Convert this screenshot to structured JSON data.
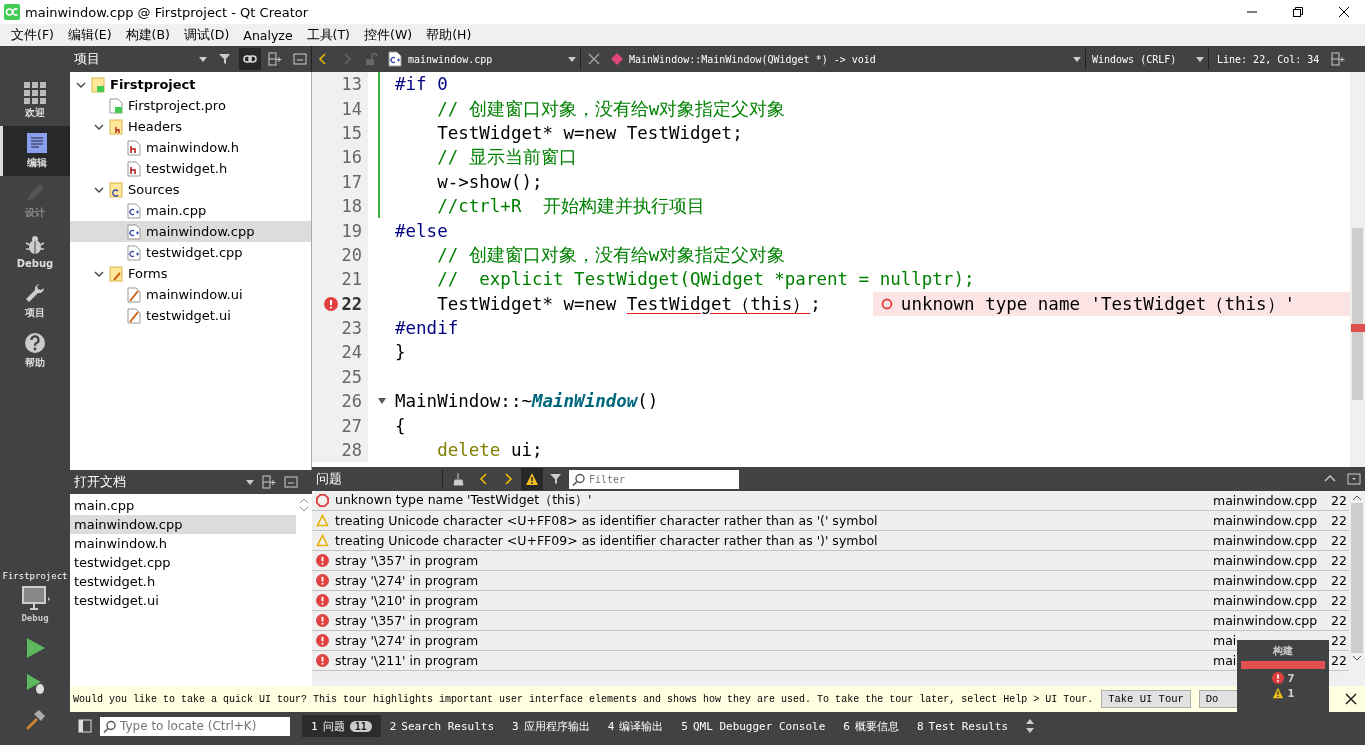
{
  "window": {
    "title": "mainwindow.cpp @ Firstproject - Qt Creator"
  },
  "menu": [
    "文件(F)",
    "编辑(E)",
    "构建(B)",
    "调试(D)",
    "Analyze",
    "工具(T)",
    "控件(W)",
    "帮助(H)"
  ],
  "modes": [
    {
      "label": "欢迎",
      "kind": "welcome",
      "selected": false,
      "disabled": false
    },
    {
      "label": "编辑",
      "kind": "edit",
      "selected": true,
      "disabled": false
    },
    {
      "label": "设计",
      "kind": "design",
      "selected": false,
      "disabled": true
    },
    {
      "label": "Debug",
      "kind": "debug",
      "selected": false,
      "disabled": false
    },
    {
      "label": "项目",
      "kind": "projects",
      "selected": false,
      "disabled": false
    },
    {
      "label": "帮助",
      "kind": "help",
      "selected": false,
      "disabled": false
    }
  ],
  "kit": {
    "project": "Firstproject",
    "build": "Debug"
  },
  "project_panel": {
    "title": "项目",
    "sync_on": true,
    "tree": [
      {
        "name": "Firstproject",
        "kind": "project",
        "expanded": true,
        "selected": false,
        "children": [
          {
            "name": "Firstproject.pro",
            "kind": "pro",
            "selected": false
          },
          {
            "name": "Headers",
            "kind": "headers",
            "expanded": true,
            "selected": false,
            "children": [
              {
                "name": "mainwindow.h",
                "kind": "h",
                "selected": false
              },
              {
                "name": "testwidget.h",
                "kind": "h",
                "selected": false
              }
            ]
          },
          {
            "name": "Sources",
            "kind": "sources",
            "expanded": true,
            "selected": false,
            "children": [
              {
                "name": "main.cpp",
                "kind": "cpp",
                "selected": false
              },
              {
                "name": "mainwindow.cpp",
                "kind": "cpp",
                "selected": true
              },
              {
                "name": "testwidget.cpp",
                "kind": "cpp",
                "selected": false
              }
            ]
          },
          {
            "name": "Forms",
            "kind": "forms",
            "expanded": true,
            "selected": false,
            "children": [
              {
                "name": "mainwindow.ui",
                "kind": "ui",
                "selected": false
              },
              {
                "name": "testwidget.ui",
                "kind": "ui",
                "selected": false
              }
            ]
          }
        ]
      }
    ]
  },
  "open_documents": {
    "title": "打开文档",
    "items": [
      {
        "name": "main.cpp",
        "selected": false
      },
      {
        "name": "mainwindow.cpp",
        "selected": true
      },
      {
        "name": "mainwindow.h",
        "selected": false
      },
      {
        "name": "testwidget.cpp",
        "selected": false
      },
      {
        "name": "testwidget.h",
        "selected": false
      },
      {
        "name": "testwidget.ui",
        "selected": false
      }
    ]
  },
  "editor": {
    "file": "mainwindow.cpp",
    "symbol": "MainWindow::MainWindow(QWidget *) -> void",
    "line_ending": "Windows (CRLF)",
    "position": "Line: 22, Col: 34",
    "lines": [
      {
        "number": "13",
        "changed": true,
        "tokens": [
          {
            "text": "#if 0",
            "kind": "preproc"
          }
        ]
      },
      {
        "number": "14",
        "changed": true,
        "tokens": [
          {
            "text": "    // 创建窗口对象，没有给w对象指定父对象",
            "kind": "comment"
          }
        ]
      },
      {
        "number": "15",
        "changed": true,
        "tokens": [
          {
            "text": "    TestWidget* w=new TestWidget;",
            "kind": "plain"
          }
        ]
      },
      {
        "number": "16",
        "changed": true,
        "tokens": [
          {
            "text": "    // 显示当前窗口",
            "kind": "comment"
          }
        ]
      },
      {
        "number": "17",
        "changed": true,
        "tokens": [
          {
            "text": "    w->show();",
            "kind": "plain"
          }
        ]
      },
      {
        "number": "18",
        "changed": true,
        "tokens": [
          {
            "text": "    //ctrl+R  开始构建并执行项目",
            "kind": "comment"
          }
        ]
      },
      {
        "number": "19",
        "tokens": [
          {
            "text": "#else",
            "kind": "preproc"
          }
        ]
      },
      {
        "number": "20",
        "tokens": [
          {
            "text": "    // 创建窗口对象，没有给w对象指定父对象",
            "kind": "comment"
          }
        ]
      },
      {
        "number": "21",
        "tokens": [
          {
            "text": "    //  explicit TestWidget(QWidget *parent = nullptr);",
            "kind": "comment"
          }
        ]
      },
      {
        "number": "22",
        "current": true,
        "error": true,
        "annotation": "unknown type name 'TestWidget（this）'",
        "tokens": [
          {
            "text": "    TestWidget* w=new ",
            "kind": "plain"
          },
          {
            "text": "TestWidget（this）",
            "kind": "error"
          },
          {
            "text": ";",
            "kind": "plain"
          }
        ]
      },
      {
        "number": "23",
        "tokens": [
          {
            "text": "#endif",
            "kind": "preproc"
          }
        ]
      },
      {
        "number": "24",
        "tokens": [
          {
            "text": "}",
            "kind": "plain"
          }
        ]
      },
      {
        "number": "25"
      },
      {
        "number": "26",
        "foldable": true,
        "tokens": [
          {
            "text": "MainWindow::~",
            "kind": "plain"
          },
          {
            "text": "MainWindow",
            "kind": "function"
          },
          {
            "text": "()",
            "kind": "plain"
          }
        ]
      },
      {
        "number": "27",
        "tokens": [
          {
            "text": "{",
            "kind": "plain"
          }
        ]
      },
      {
        "number": "28",
        "tokens": [
          {
            "text": "    delete",
            "kind": "keyword"
          },
          {
            "text": " ui;",
            "kind": "plain"
          }
        ]
      }
    ]
  },
  "issues_panel": {
    "title": "问题",
    "filter_placeholder": "Filter",
    "warnings_on": true,
    "rows": [
      {
        "kind": "clang",
        "text": "unknown type name 'TestWidget（this）'",
        "file": "mainwindow.cpp",
        "line": "22"
      },
      {
        "kind": "warning",
        "text": "treating Unicode character <U+FF08> as identifier character rather than as '(' symbol",
        "file": "mainwindow.cpp",
        "line": "22"
      },
      {
        "kind": "warning",
        "text": "treating Unicode character <U+FF09> as identifier character rather than as ')' symbol",
        "file": "mainwindow.cpp",
        "line": "22"
      },
      {
        "kind": "error",
        "text": "stray '\\357' in program",
        "file": "mainwindow.cpp",
        "line": "22"
      },
      {
        "kind": "error",
        "text": "stray '\\274' in program",
        "file": "mainwindow.cpp",
        "line": "22"
      },
      {
        "kind": "error",
        "text": "stray '\\210' in program",
        "file": "mainwindow.cpp",
        "line": "22"
      },
      {
        "kind": "error",
        "text": "stray '\\357' in program",
        "file": "mainwindow.cpp",
        "line": "22"
      },
      {
        "kind": "error",
        "text": "stray '\\274' in program",
        "file": "mai",
        "line": "22"
      },
      {
        "kind": "error",
        "text": "stray '\\211' in program",
        "file": "mai",
        "line": "22"
      }
    ]
  },
  "tour": {
    "text": "Would you like to take a quick UI tour? This tour highlights important user interface elements and shows how they are used. To take the tour later, select Help > UI Tour.",
    "buttons": [
      "Take UI Tour",
      "Do"
    ]
  },
  "status_bar": {
    "locate_placeholder": "Type to locate (Ctrl+K)",
    "panes": [
      {
        "number": "1",
        "label": "问题",
        "badge": "11",
        "selected": true
      },
      {
        "number": "2",
        "label": "Search Results",
        "selected": false
      },
      {
        "number": "3",
        "label": "应用程序输出",
        "selected": false
      },
      {
        "number": "4",
        "label": "编译输出",
        "selected": false
      },
      {
        "number": "5",
        "label": "QML Debugger Console",
        "selected": false
      },
      {
        "number": "6",
        "label": "概要信息",
        "selected": false
      },
      {
        "number": "8",
        "label": "Test Results",
        "selected": false
      }
    ]
  },
  "build_popup": {
    "title": "构建",
    "level": 1,
    "errors": "7",
    "warnings": "1"
  }
}
